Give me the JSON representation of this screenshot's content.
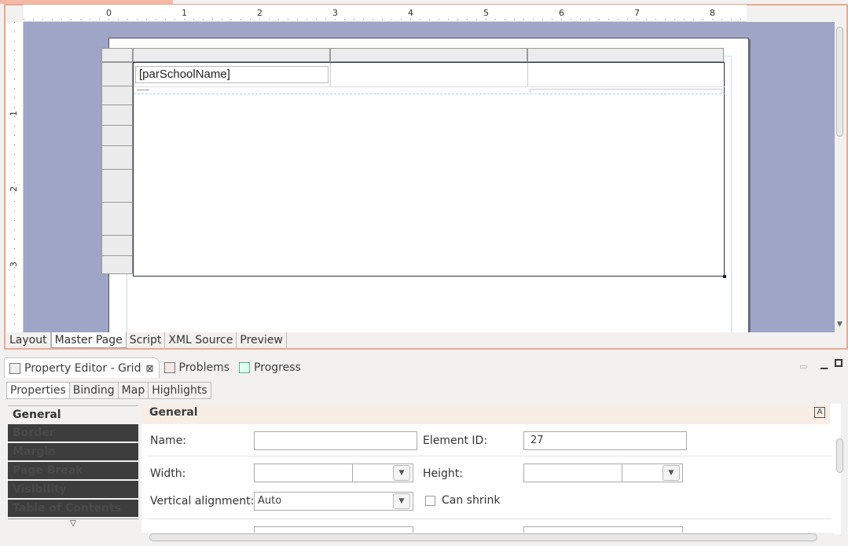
{
  "editor": {
    "ruler_h_labels": [
      "0",
      "1",
      "2",
      "3",
      "4",
      "5",
      "6",
      "7",
      "8"
    ],
    "ruler_v_labels": [
      "1",
      "2",
      "3"
    ],
    "cell_text": "[parSchoolName]",
    "layout_tabs": [
      {
        "label": "Layout",
        "active": false
      },
      {
        "label": "Master Page",
        "active": true
      },
      {
        "label": "Script",
        "active": false
      },
      {
        "label": "XML Source",
        "active": false
      },
      {
        "label": "Preview",
        "active": false
      }
    ]
  },
  "panel": {
    "tabs": [
      {
        "label": "Property Editor - Grid",
        "icon": "property-editor-icon",
        "active": true
      },
      {
        "label": "Problems",
        "icon": "problems-icon",
        "active": false
      },
      {
        "label": "Progress",
        "icon": "progress-icon",
        "active": false
      }
    ],
    "sub_tabs": [
      "Properties",
      "Binding",
      "Map",
      "Highlights"
    ],
    "categories": [
      "General",
      "Border",
      "Margin",
      "Page Break",
      "Visibility",
      "Table of Contents"
    ],
    "section_title": "General",
    "fields": {
      "name_label": "Name:",
      "name_value": "",
      "element_id_label": "Element ID:",
      "element_id_value": "27",
      "width_label": "Width:",
      "height_label": "Height:",
      "valign_label": "Vertical alignment:",
      "valign_value": "Auto",
      "can_shrink_label": "Can shrink"
    }
  }
}
